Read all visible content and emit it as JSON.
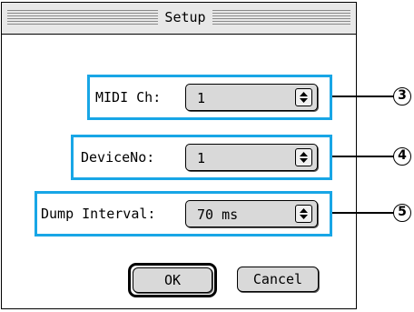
{
  "window": {
    "title": "Setup"
  },
  "rows": [
    {
      "label": "MIDI Ch:",
      "value": "1",
      "callout": "3"
    },
    {
      "label": "DeviceNo:",
      "value": "1",
      "callout": "4"
    },
    {
      "label": "Dump Interval:",
      "value": "70 ms",
      "callout": "5"
    }
  ],
  "buttons": {
    "ok": "OK",
    "cancel": "Cancel"
  },
  "colors": {
    "highlight_frame": "#18a6e6",
    "popup_fill": "#d9d9d9",
    "titlebar": "#e8e8e8"
  },
  "icons": {
    "popup_arrow": "up-down-arrows-icon"
  }
}
